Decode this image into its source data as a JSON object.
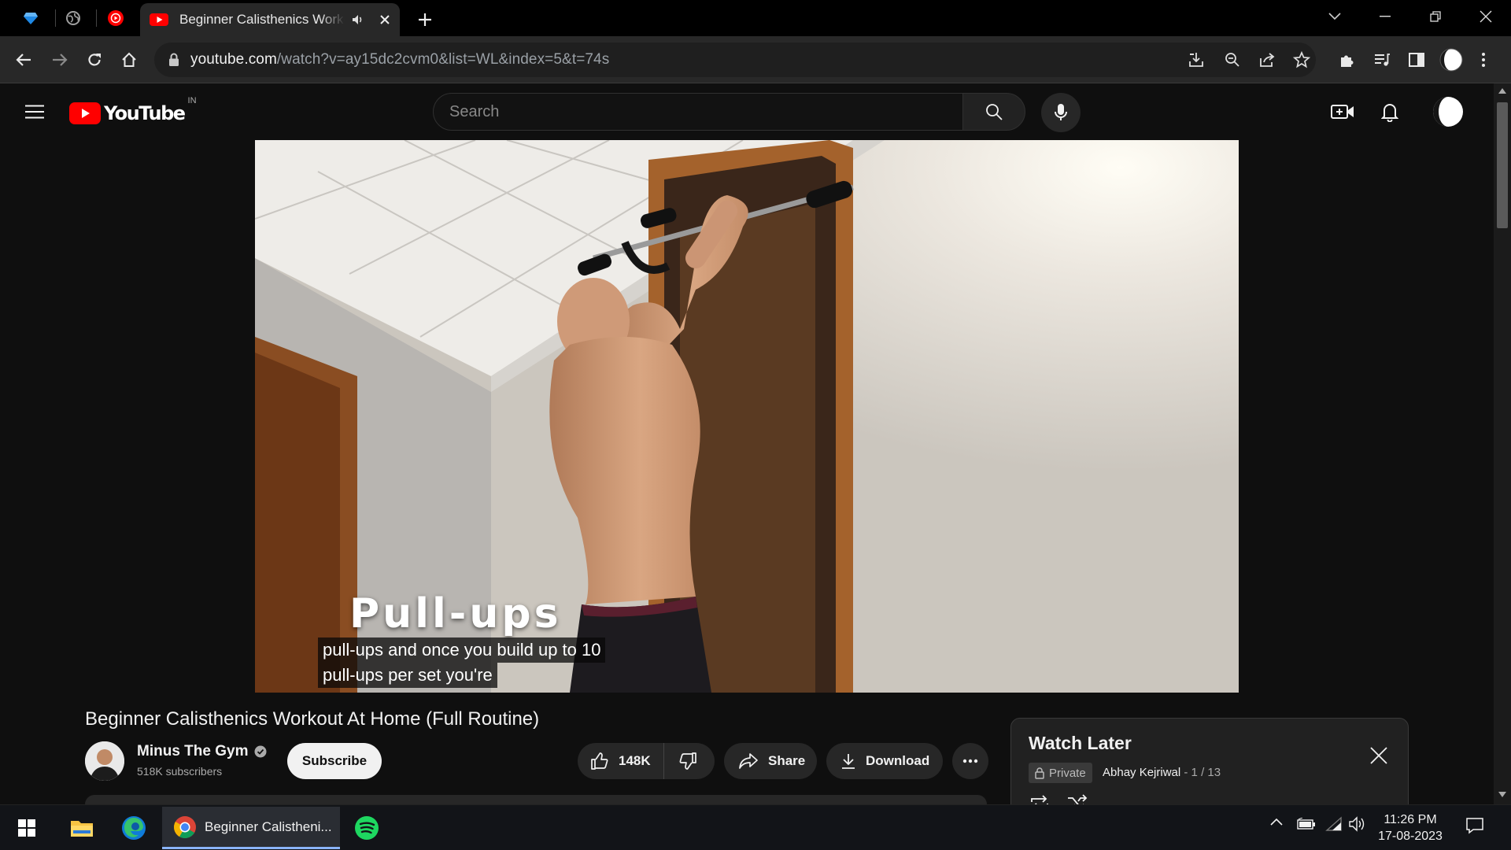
{
  "browser": {
    "active_tab_title": "Beginner Calisthenics Workout At Home (Full Routine)",
    "url_host": "youtube.com",
    "url_path": "/watch?v=ay15dc2cvm0&list=WL&index=5&t=74s"
  },
  "youtube": {
    "logo_text": "YouTube",
    "country_code": "IN",
    "search_placeholder": "Search"
  },
  "video": {
    "overlay_title": "Pull-ups",
    "captions": [
      "pull-ups and once you build up to 10",
      "pull-ups per set you're"
    ],
    "title": "Beginner Calisthenics Workout At Home (Full Routine)"
  },
  "channel": {
    "name": "Minus The Gym",
    "subscribers": "518K subscribers",
    "subscribe_label": "Subscribe"
  },
  "actions": {
    "likes": "148K",
    "share_label": "Share",
    "download_label": "Download"
  },
  "watch_later": {
    "title": "Watch Later",
    "privacy": "Private",
    "owner": "Abhay Kejriwal",
    "index": "- 1 / 13"
  },
  "taskbar": {
    "chrome_window_title": "Beginner Calistheni...",
    "time": "11:26 PM",
    "date": "17-08-2023"
  },
  "colors": {
    "youtube_red": "#ff0000",
    "background": "#0f0f0f",
    "panel": "#212121"
  }
}
